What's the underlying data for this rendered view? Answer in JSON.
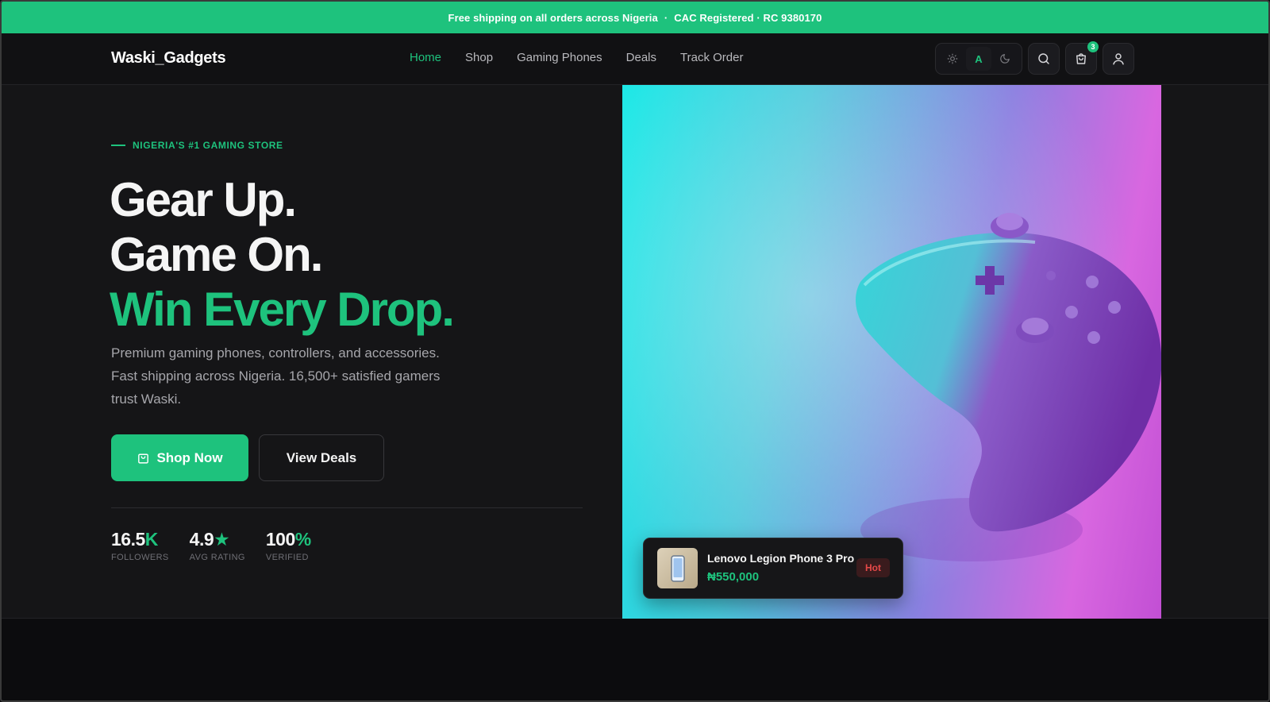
{
  "announcement": {
    "shipping": "Free shipping on all orders across Nigeria",
    "separator": "·",
    "registration": "CAC Registered · RC 9380170"
  },
  "header": {
    "logo": "Waski_Gadgets",
    "nav": [
      "Home",
      "Shop",
      "Gaming Phones",
      "Deals",
      "Track Order"
    ],
    "active_nav": "Home",
    "theme_auto_label": "A",
    "cart_count": "3",
    "icons": [
      "sun-icon",
      "moon-icon",
      "search-icon",
      "cart-icon",
      "user-icon"
    ]
  },
  "hero": {
    "eyebrow": "NIGERIA'S #1 GAMING STORE",
    "headline_line1": "Gear Up.",
    "headline_line2": "Game On.",
    "headline_line3": "Win Every Drop.",
    "description": "Premium gaming phones, controllers, and accessories. Fast shipping across Nigeria. 16,500+ satisfied gamers trust Waski.",
    "primary_cta": "Shop Now",
    "secondary_cta": "View Deals",
    "stats": [
      {
        "value": "16.5",
        "accent": "K",
        "label": "FOLLOWERS"
      },
      {
        "value": "4.9",
        "accent": "★",
        "label": "AVG RATING"
      },
      {
        "value": "100",
        "accent": "%",
        "label": "VERIFIED"
      }
    ]
  },
  "featured_product": {
    "name": "Lenovo Legion Phone 3 Pro",
    "price": "₦550,000",
    "badge": "Hot"
  },
  "colors": {
    "accent": "#1ec27d",
    "background": "#151517",
    "hot": "#e54848"
  }
}
